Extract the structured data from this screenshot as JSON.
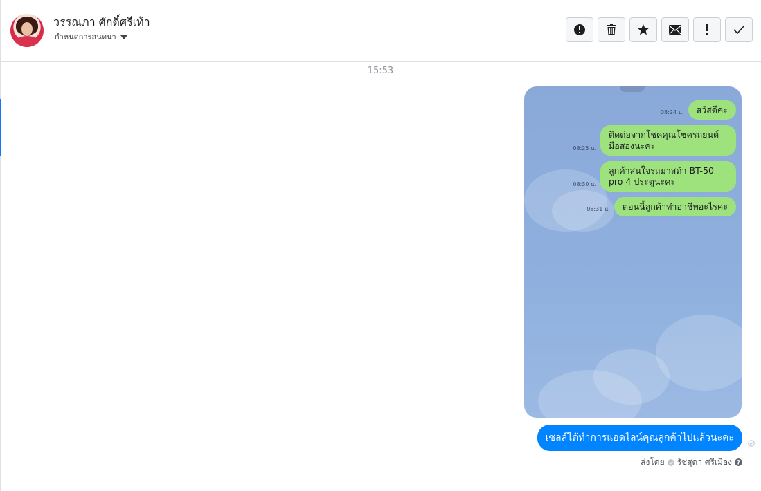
{
  "header": {
    "contact_name": "วรรณภา ศักดิ์ศรีเท้า",
    "assign_label": "กำหนดการสนทนา",
    "toolbar": [
      {
        "name": "report-spam-button",
        "icon": "exclamation-circle-icon"
      },
      {
        "name": "delete-button",
        "icon": "trash-icon"
      },
      {
        "name": "star-button",
        "icon": "star-icon"
      },
      {
        "name": "mark-unread-button",
        "icon": "envelope-icon"
      },
      {
        "name": "follow-up-button",
        "icon": "exclamation-icon"
      },
      {
        "name": "mark-done-button",
        "icon": "check-icon"
      }
    ]
  },
  "conversation": {
    "time_divider": "15:53",
    "screenshot_messages": [
      {
        "time": "08:24 น.",
        "text": "สวัสดีคะ"
      },
      {
        "time": "08:25 น.",
        "text": "ติดต่อจากโชคคุณโชครถยนต์มือสองนะคะ"
      },
      {
        "time": "08:30 น.",
        "text": "ลูกค้าสนใจรถมาสด้า BT-50 pro 4 ประตูนะคะ"
      },
      {
        "time": "08:31 น.",
        "text": "ตอนนี้ลูกค้าทำอาชีพอะไรคะ"
      }
    ],
    "sent_message": "เซลล์ได้ทำการแอดไลน์คุณลูกค้าไปแล้วนะคะ",
    "sent_by_label": "ส่งโดย",
    "sent_by_name": "รัชสุดา ศรีเมือง"
  },
  "colors": {
    "accent": "#1877f2",
    "sent_bubble": "#0084ff",
    "line_bubble": "#9ee27e",
    "line_background": "#8fb0de"
  }
}
